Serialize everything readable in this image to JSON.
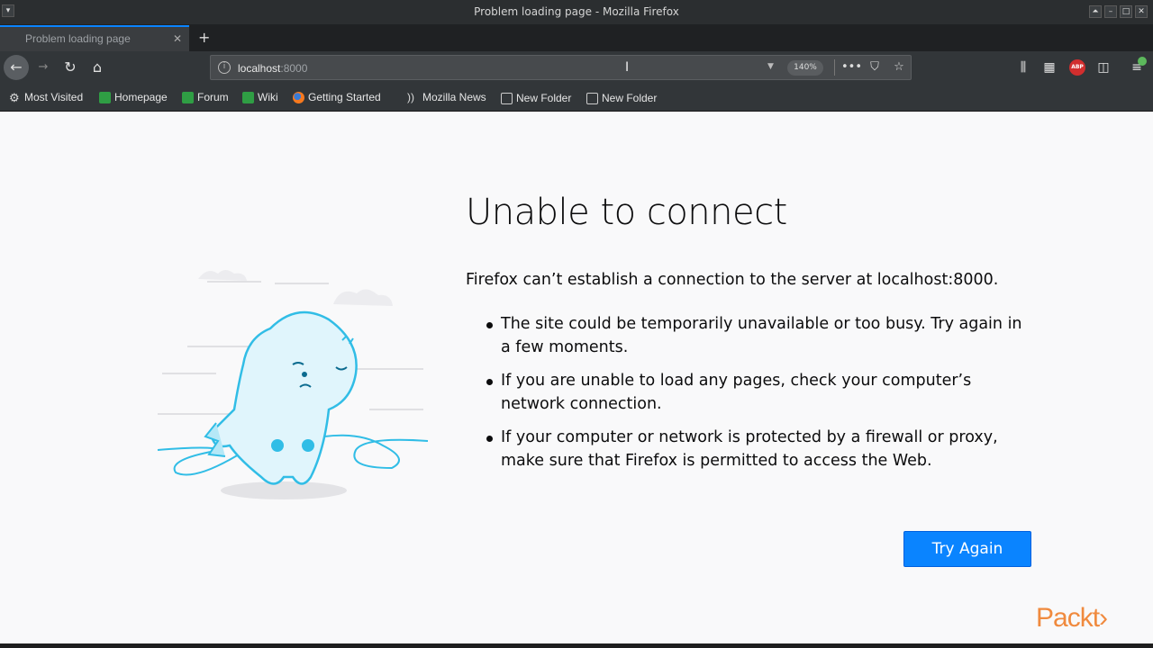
{
  "window": {
    "title": "Problem loading page - Mozilla Firefox"
  },
  "tabs": [
    {
      "label": "Problem loading page"
    }
  ],
  "urlbar": {
    "host": "localhost",
    "port": ":8000",
    "zoom": "140%"
  },
  "bookmarks": [
    {
      "label": "Most Visited",
      "icon": "gear-icon"
    },
    {
      "label": "Homepage",
      "icon": "green-page-icon"
    },
    {
      "label": "Forum",
      "icon": "green-page-icon"
    },
    {
      "label": "Wiki",
      "icon": "green-page-icon"
    },
    {
      "label": "Getting Started",
      "icon": "firefox-icon"
    },
    {
      "label": "Mozilla News",
      "icon": "rss-icon"
    },
    {
      "label": "New Folder",
      "icon": "folder-icon"
    },
    {
      "label": "New Folder",
      "icon": "folder-icon"
    }
  ],
  "error": {
    "heading": "Unable to connect",
    "description": "Firefox can’t establish a connection to the server at localhost:8000.",
    "reasons": [
      "The site could be temporarily unavailable or too busy. Try again in a few moments.",
      "If you are unable to load any pages, check your computer’s network connection.",
      "If your computer or network is protected by a firewall or proxy, make sure that Firefox is permitted to access the Web."
    ],
    "button": "Try Again"
  },
  "watermark": "Packt›",
  "colors": {
    "accent": "#0a84ff",
    "chrome": "#323639",
    "watermark": "#f08a3e"
  }
}
